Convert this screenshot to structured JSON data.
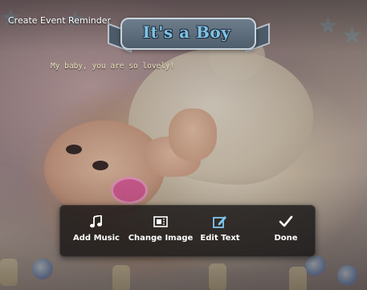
{
  "window": {
    "title": "Create Event Reminder"
  },
  "photo": {
    "banner_text": "It's a Boy",
    "caption": "My baby, you are so lovely!"
  },
  "toolbar": {
    "items": [
      {
        "label": "Add Music",
        "icon": "music-note-icon"
      },
      {
        "label": "Change Image",
        "icon": "image-frame-icon"
      },
      {
        "label": "Edit Text",
        "icon": "edit-text-icon",
        "color": "#7fc6ee"
      },
      {
        "label": "Done",
        "icon": "check-icon"
      }
    ]
  },
  "colors": {
    "toolbar_bg": "#191616",
    "accent": "#7fc6ee",
    "label": "#ffffff"
  }
}
